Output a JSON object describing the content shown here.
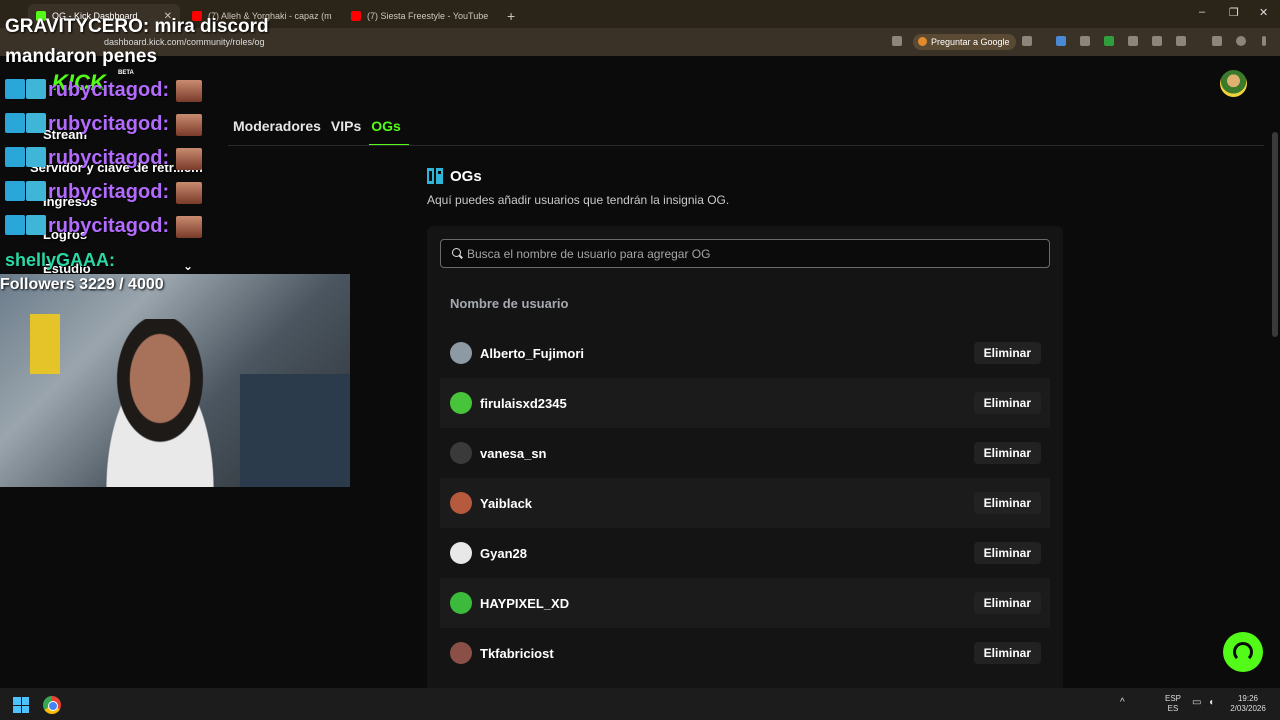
{
  "browser": {
    "tabs": [
      {
        "title": "OG - Kick Dashboard",
        "active": true
      },
      {
        "title": "(7) Alleh & Yorghaki - capaz (m",
        "active": false
      },
      {
        "title": "(7) Siesta Freestyle - YouTube",
        "active": false
      }
    ],
    "new_tab": "+",
    "url": "dashboard.kick.com/community/roles/og",
    "ask_google": "Preguntar a Google",
    "window_controls": [
      "–",
      "❐",
      "✕"
    ]
  },
  "dashboard": {
    "role_tabs": [
      {
        "label": "Moderadores",
        "active": false
      },
      {
        "label": "VIPs",
        "active": false
      },
      {
        "label": "OGs",
        "active": true
      }
    ],
    "section_title": "OGs",
    "section_desc": "Aquí puedes añadir usuarios que tendrán la insignia OG.",
    "search_placeholder": "Busca el nombre de usuario para agregar OG",
    "column_header": "Nombre de usuario",
    "delete_label": "Eliminar",
    "users": [
      {
        "name": "Alberto_Fujimori",
        "avatar_color": "#8d9aa3"
      },
      {
        "name": "firulaisxd2345",
        "avatar_color": "#47c43a"
      },
      {
        "name": "vanesa_sn",
        "avatar_color": "#3a3a3a"
      },
      {
        "name": "Yaiblack",
        "avatar_color": "#b55a3c"
      },
      {
        "name": "Gyan28",
        "avatar_color": "#e8e8e8"
      },
      {
        "name": "HAYPIXEL_XD",
        "avatar_color": "#3cba3c"
      },
      {
        "name": "Tkfabriciost",
        "avatar_color": "#8a5048"
      }
    ],
    "accent": "#53fc18"
  },
  "stream_overlay": {
    "alert_line1": "GRAVITYCERO: mira discord",
    "alert_line2": "mandaron penes",
    "kick_logo": "KICK",
    "kick_beta": "BETA",
    "chat": [
      {
        "user": "rubycitagod:"
      },
      {
        "user": "rubycitagod:"
      },
      {
        "user": "rubycitagod:"
      },
      {
        "user": "rubycitagod:"
      },
      {
        "user": "rubycitagod:"
      }
    ],
    "chat_user2": "shellyGAAA:",
    "followers": "Followers 3229 / 4000",
    "sidebar_items": [
      "Stream",
      "Servidor y clave de retr...em",
      "Ingresos",
      "Logros",
      "Estudio"
    ]
  },
  "taskbar": {
    "lang_top": "ESP",
    "lang_bottom": "ES",
    "time": "19:26",
    "date": "2/03/2026"
  }
}
